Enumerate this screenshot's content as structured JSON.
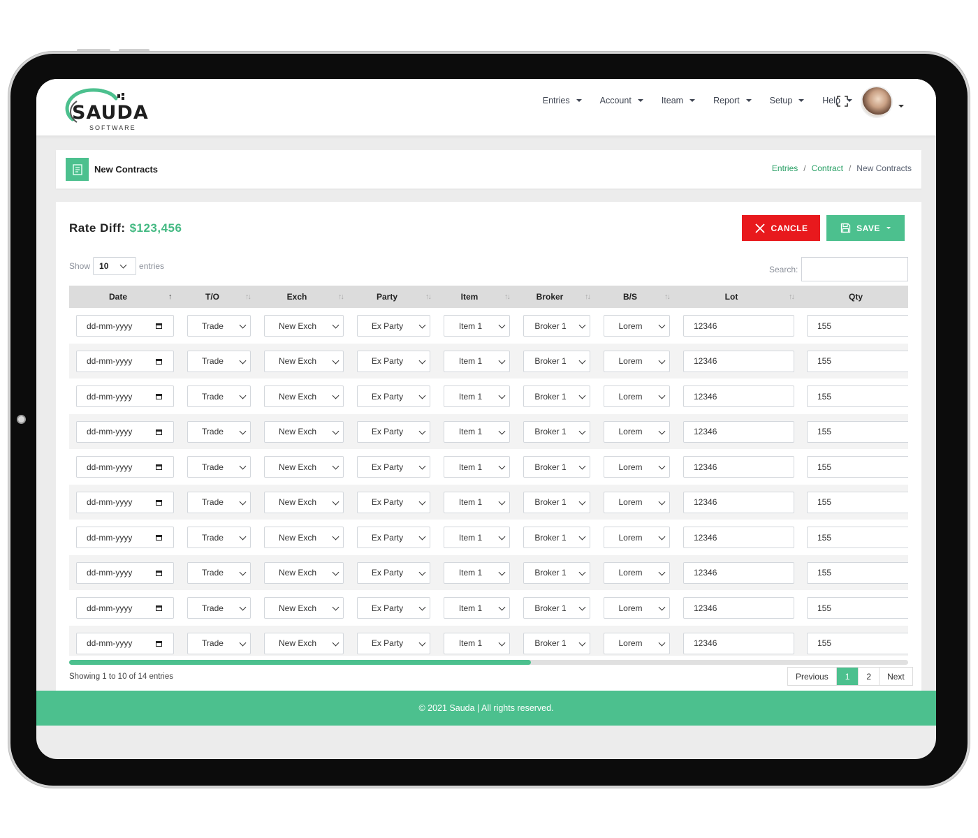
{
  "brand": {
    "name": "SAUDA",
    "tagline": "SOFTWARE",
    "accent": "#4cc08e",
    "danger": "#e8191d"
  },
  "nav": {
    "items": [
      "Entries",
      "Account",
      "Iteam",
      "Report",
      "Setup",
      "Help"
    ],
    "icons": [
      "fullscreen-icon",
      "avatar"
    ]
  },
  "page": {
    "title": "New Contracts",
    "breadcrumb": [
      "Entries",
      "Contract",
      "New Contracts"
    ]
  },
  "rate_diff": {
    "label": "Rate Diff:",
    "amount": "$123,456"
  },
  "actions": {
    "cancel": "CANCLE",
    "save": "SAVE"
  },
  "table_controls": {
    "show": "Show",
    "page_size": "10",
    "entries": "entries",
    "search_label": "Search:"
  },
  "table": {
    "columns": [
      "Date",
      "T/O",
      "Exch",
      "Party",
      "Item",
      "Broker",
      "B/S",
      "Lot",
      "Qty"
    ],
    "rows": [
      {
        "date": "dd-mm-yyyy",
        "to": "Trade",
        "exch": "New Exch",
        "party": "Ex Party",
        "item": "Item 1",
        "broker": "Broker 1",
        "bs": "Lorem",
        "lot": "12346",
        "qty": "155"
      },
      {
        "date": "dd-mm-yyyy",
        "to": "Trade",
        "exch": "New Exch",
        "party": "Ex Party",
        "item": "Item 1",
        "broker": "Broker 1",
        "bs": "Lorem",
        "lot": "12346",
        "qty": "155"
      },
      {
        "date": "dd-mm-yyyy",
        "to": "Trade",
        "exch": "New Exch",
        "party": "Ex Party",
        "item": "Item 1",
        "broker": "Broker 1",
        "bs": "Lorem",
        "lot": "12346",
        "qty": "155"
      },
      {
        "date": "dd-mm-yyyy",
        "to": "Trade",
        "exch": "New Exch",
        "party": "Ex Party",
        "item": "Item 1",
        "broker": "Broker 1",
        "bs": "Lorem",
        "lot": "12346",
        "qty": "155"
      },
      {
        "date": "dd-mm-yyyy",
        "to": "Trade",
        "exch": "New Exch",
        "party": "Ex Party",
        "item": "Item 1",
        "broker": "Broker 1",
        "bs": "Lorem",
        "lot": "12346",
        "qty": "155"
      },
      {
        "date": "dd-mm-yyyy",
        "to": "Trade",
        "exch": "New Exch",
        "party": "Ex Party",
        "item": "Item 1",
        "broker": "Broker 1",
        "bs": "Lorem",
        "lot": "12346",
        "qty": "155"
      },
      {
        "date": "dd-mm-yyyy",
        "to": "Trade",
        "exch": "New Exch",
        "party": "Ex Party",
        "item": "Item 1",
        "broker": "Broker 1",
        "bs": "Lorem",
        "lot": "12346",
        "qty": "155"
      },
      {
        "date": "dd-mm-yyyy",
        "to": "Trade",
        "exch": "New Exch",
        "party": "Ex Party",
        "item": "Item 1",
        "broker": "Broker 1",
        "bs": "Lorem",
        "lot": "12346",
        "qty": "155"
      },
      {
        "date": "dd-mm-yyyy",
        "to": "Trade",
        "exch": "New Exch",
        "party": "Ex Party",
        "item": "Item 1",
        "broker": "Broker 1",
        "bs": "Lorem",
        "lot": "12346",
        "qty": "155"
      },
      {
        "date": "dd-mm-yyyy",
        "to": "Trade",
        "exch": "New Exch",
        "party": "Ex Party",
        "item": "Item 1",
        "broker": "Broker 1",
        "bs": "Lorem",
        "lot": "12346",
        "qty": "155"
      }
    ],
    "horizontal_scroll_fraction": 0.55
  },
  "pagination": {
    "info": "Showing 1 to 10 of 14 entries",
    "previous": "Previous",
    "pages": [
      "1",
      "2"
    ],
    "current": "1",
    "next": "Next"
  },
  "footer": {
    "text": "© 2021 Sauda | All rights reserved."
  }
}
